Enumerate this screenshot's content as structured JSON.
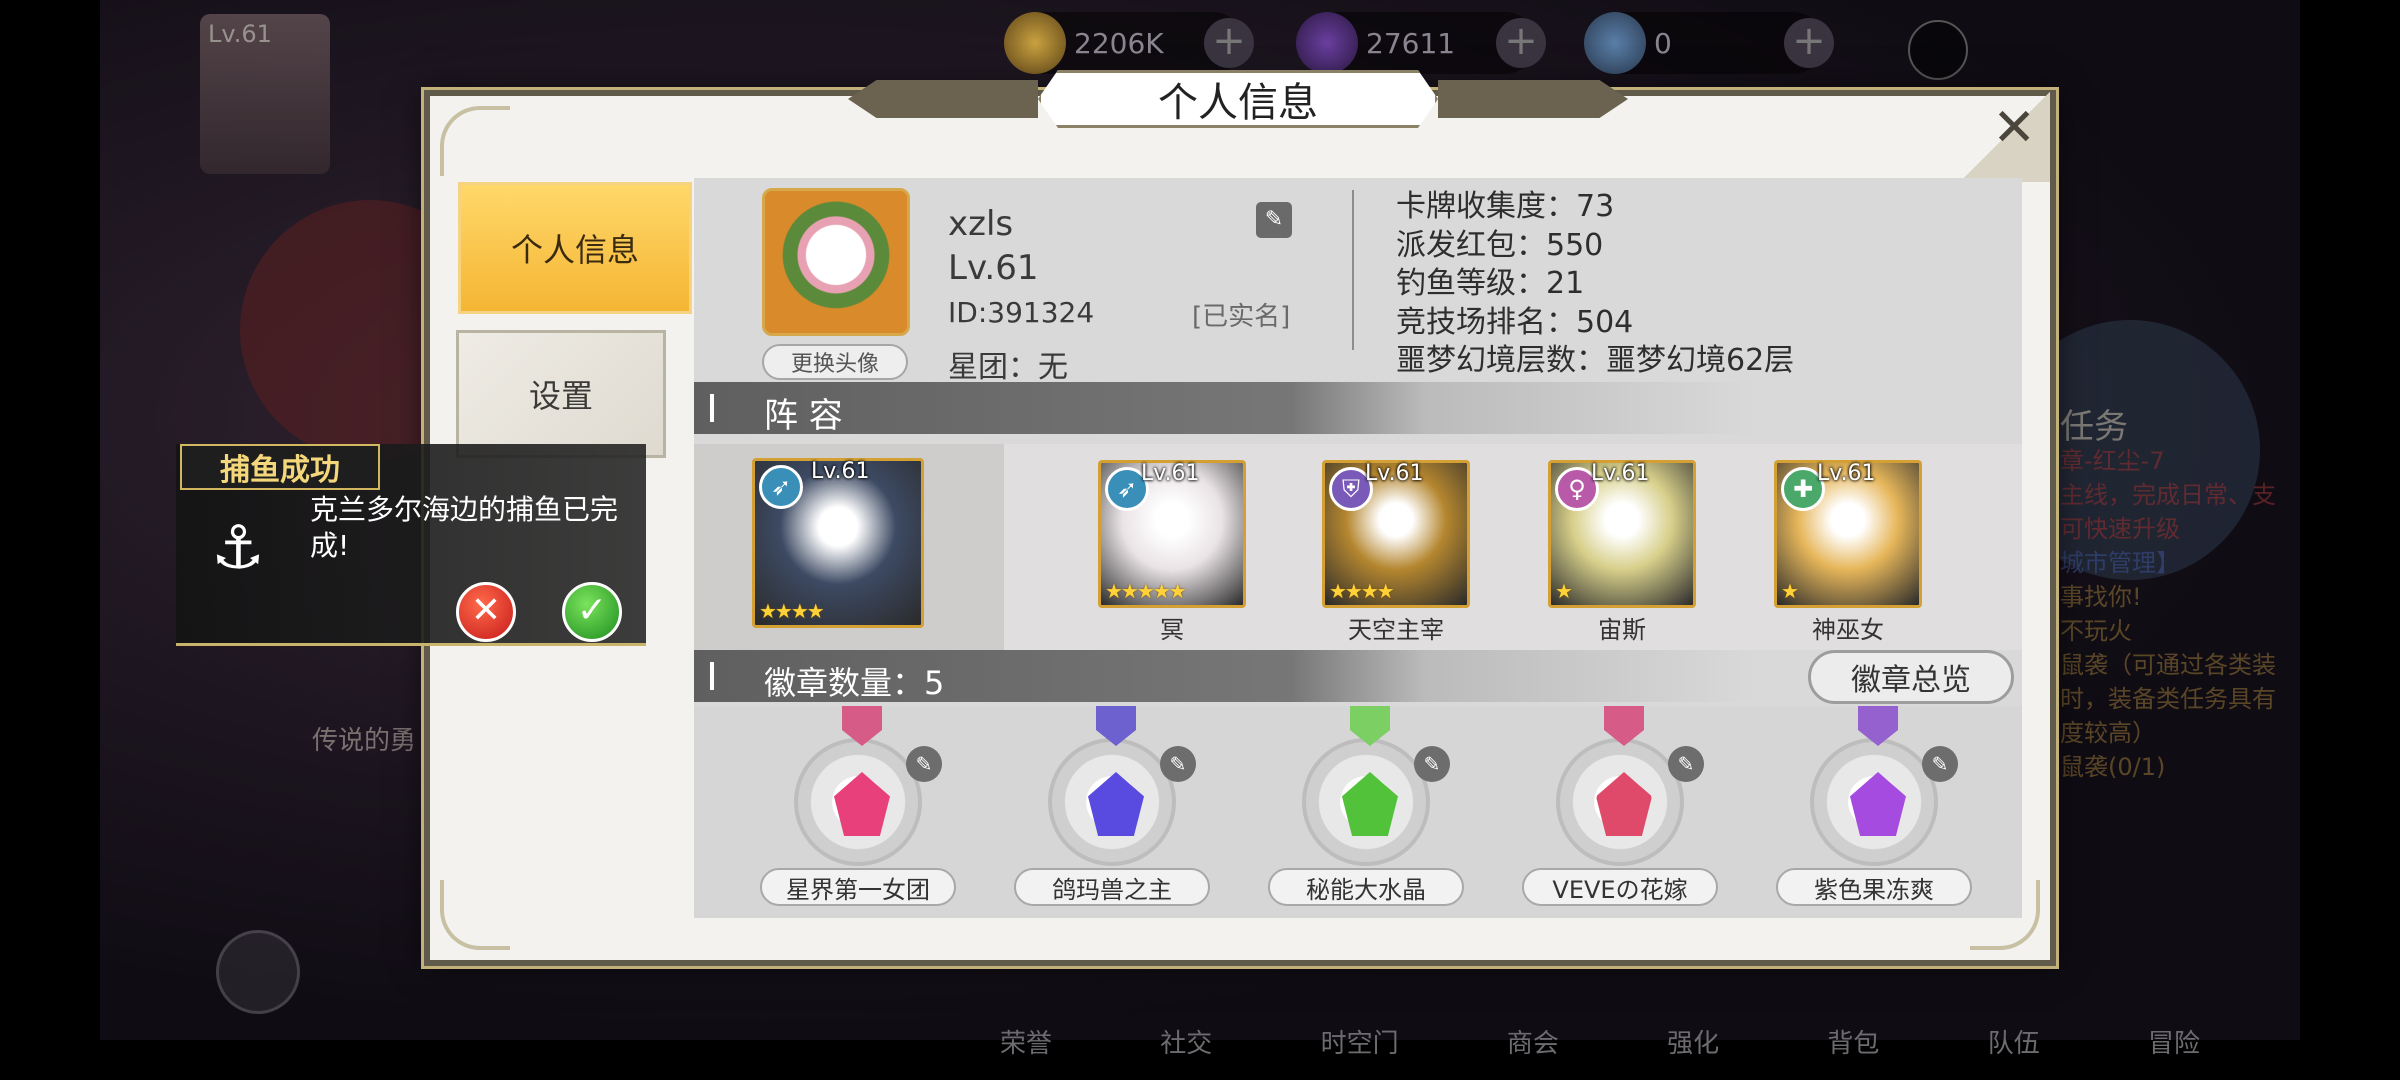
{
  "hud": {
    "player_level": "Lv.61",
    "gold": "2206K",
    "gems": "27611",
    "third_currency": "0",
    "plus": "+"
  },
  "bottom_nav": [
    "荣誉",
    "社交",
    "时空门",
    "商会",
    "强化",
    "背包",
    "队伍",
    "冒险"
  ],
  "bg_right_text": [
    "任务",
    "章-红尘-7",
    "主线，完成日常、支",
    "可快速升级",
    "城市管理】",
    "事找你!",
    "不玩火",
    "鼠袭（可通过各类装",
    "时，装备类任务具有",
    "度较高）",
    "鼠袭(0/1)"
  ],
  "bg_left_text": "传说的勇",
  "modal": {
    "title": "个人信息",
    "close_glyph": "✕",
    "tabs": [
      {
        "label": "个人信息",
        "active": true
      },
      {
        "label": "设置",
        "active": false
      }
    ],
    "profile": {
      "name": "xzls",
      "level": "Lv.61",
      "id": "ID:391324",
      "verified": "[已实名]",
      "guild": "星团：无",
      "change_avatar": "更换头像"
    },
    "stats": [
      "卡牌收集度：73",
      "派发红包：550",
      "钓鱼等级：21",
      "竞技场排名：504",
      "噩梦幻境层数：噩梦幻境62层"
    ],
    "lineup_header": "阵 容",
    "heroes": [
      {
        "level": "Lv.61",
        "name": "",
        "stars": "★★★★",
        "class_icon": "bow-icon",
        "color": "#3d4a63"
      },
      {
        "level": "Lv.61",
        "name": "冥",
        "stars": "★★★★★",
        "class_icon": "bow-icon",
        "color": "#e9e3e6"
      },
      {
        "level": "Lv.61",
        "name": "天空主宰",
        "stars": "★★★★",
        "class_icon": "shield-icon",
        "color": "#b4862f"
      },
      {
        "level": "Lv.61",
        "name": "宙斯",
        "stars": "★",
        "class_icon": "female-icon",
        "color": "#d7cf8a"
      },
      {
        "level": "Lv.61",
        "name": "神巫女",
        "stars": "★",
        "class_icon": "cross-icon",
        "color": "#e6b65a"
      }
    ],
    "badge_header": "徽章数量：5",
    "badge_overview": "徽章总览",
    "badges": [
      {
        "name": "星界第一女团",
        "gem_color": "#e8407a",
        "ribbon": "#d65b86"
      },
      {
        "name": "鸽玛兽之主",
        "gem_color": "#5a4be0",
        "ribbon": "#6c61cf"
      },
      {
        "name": "秘能大水晶",
        "gem_color": "#52c23a",
        "ribbon": "#7bcf63"
      },
      {
        "name": "VEVEの花嫁",
        "gem_color": "#e04a6a",
        "ribbon": "#d65b86"
      },
      {
        "name": "紫色果冻爽",
        "gem_color": "#a64be0",
        "ribbon": "#9461cf"
      }
    ]
  },
  "notification": {
    "title": "捕鱼成功",
    "message": "克兰多尔海边的捕鱼已完成!",
    "cancel": "✕",
    "confirm": "✓"
  }
}
